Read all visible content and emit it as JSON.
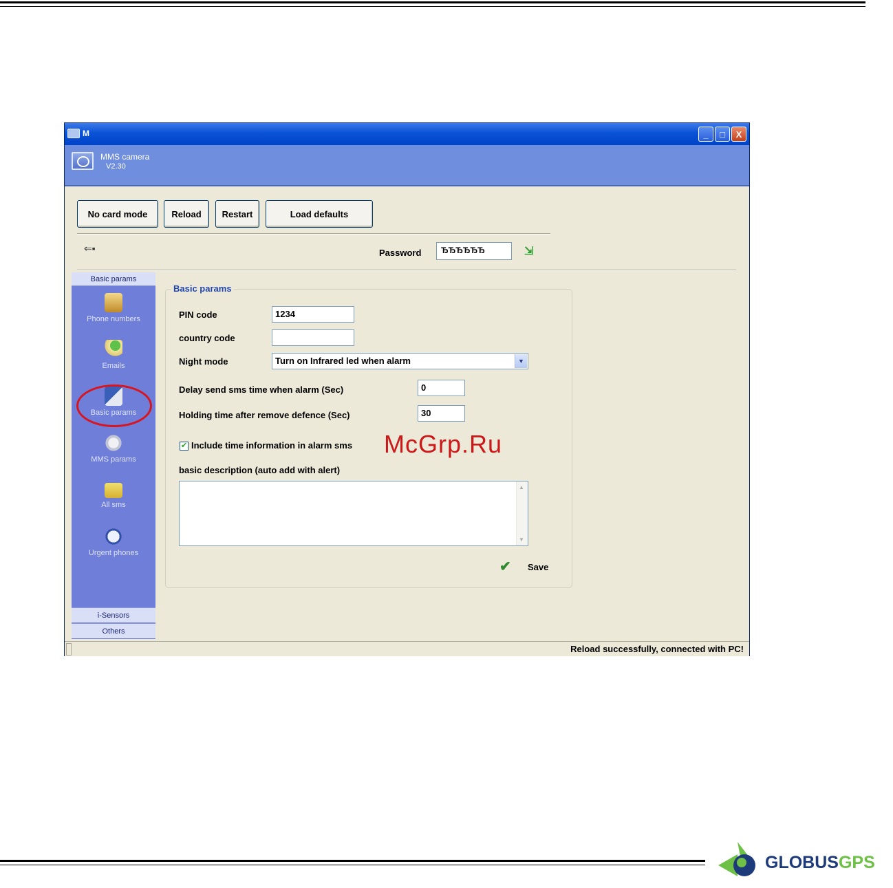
{
  "window": {
    "title": "M",
    "app_name": "MMS camera",
    "app_version": "V2.30",
    "minimize": "_",
    "maximize": "□",
    "close": "X"
  },
  "toolbar": {
    "no_card_mode": "No card mode",
    "reload": "Reload",
    "restart": "Restart",
    "load_defaults": "Load defaults"
  },
  "password": {
    "label": "Password",
    "value": "ЂЂЂЂЂЂ"
  },
  "sidebar": {
    "header": "Basic params",
    "items": [
      {
        "label": "Phone numbers",
        "icon": "phone-book-icon"
      },
      {
        "label": "Emails",
        "icon": "email-pin-icon"
      },
      {
        "label": "Basic params",
        "icon": "basic-params-icon"
      },
      {
        "label": "MMS params",
        "icon": "mms-gear-icon"
      },
      {
        "label": "All sms",
        "icon": "sms-envelope-icon"
      },
      {
        "label": "Urgent phones",
        "icon": "urgent-phone-icon"
      }
    ],
    "footer": [
      "i-Sensors",
      "Others"
    ]
  },
  "form": {
    "group_title": "Basic params",
    "pin_code_label": "PIN code",
    "pin_code_value": "1234",
    "country_code_label": "country code",
    "country_code_value": "",
    "night_mode_label": "Night mode",
    "night_mode_value": "Turn on Infrared led when alarm",
    "delay_label": "Delay send sms time when alarm (Sec)",
    "delay_value": "0",
    "holding_label": "Holding time after remove defence (Sec)",
    "holding_value": "30",
    "include_time_label": "Include time information in alarm sms",
    "include_time_checked": true,
    "description_label": "basic description (auto add with alert)",
    "description_value": "",
    "save_label": "Save"
  },
  "watermark": "McGrp.Ru",
  "status": {
    "text": "Reload successfully, connected with PC!"
  },
  "logo": {
    "part1": "GLOBUS",
    "part2": "GPS"
  },
  "colors": {
    "sidebar_bg": "#6f7ed8",
    "header_band": "#6f8ede",
    "titlebar": "#0a52d6",
    "highlight_ring": "#d8141e",
    "group_title": "#2146b0"
  }
}
